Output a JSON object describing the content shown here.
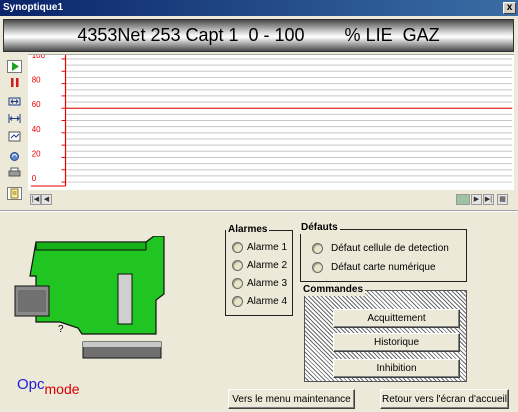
{
  "window": {
    "title": "Synoptique1",
    "close_label": "x"
  },
  "header": {
    "title": "4353Net 253 Capt 1  0 - 100        % LIE  GAZ"
  },
  "toolbar": {
    "icons": [
      "play-icon",
      "pause-icon",
      "zoom-horizontal-icon",
      "fit-horizontal-icon",
      "autoscale-icon",
      "refresh-icon",
      "print-icon",
      "notes-icon"
    ]
  },
  "chart_data": {
    "type": "line",
    "yticks": [
      "100",
      "80",
      "60",
      "40",
      "20",
      "0"
    ],
    "ylim": [
      0,
      100
    ],
    "hlines": [
      60
    ],
    "series": [],
    "grid": true,
    "colors": {
      "axis": "#e60000",
      "grid": "#c8c8c8"
    }
  },
  "alarmes": {
    "title": "Alarmes",
    "items": [
      "Alarme 1",
      "Alarme 2",
      "Alarme 3",
      "Alarme 4"
    ]
  },
  "defauts": {
    "title": "Défauts",
    "items": [
      "Défaut cellule de detection",
      "Défaut carte numérique"
    ]
  },
  "commandes": {
    "title": "Commandes",
    "buttons": [
      "Acquittement",
      "Historique",
      "Inhibition"
    ]
  },
  "device": {
    "question_mark": "?",
    "color": "#21c521"
  },
  "footer": {
    "maintenance_button": "Vers le menu maintenance",
    "home_button": "Retour vers l'écran d'accueil",
    "logo_main": "Opc",
    "logo_sub": "mode"
  }
}
